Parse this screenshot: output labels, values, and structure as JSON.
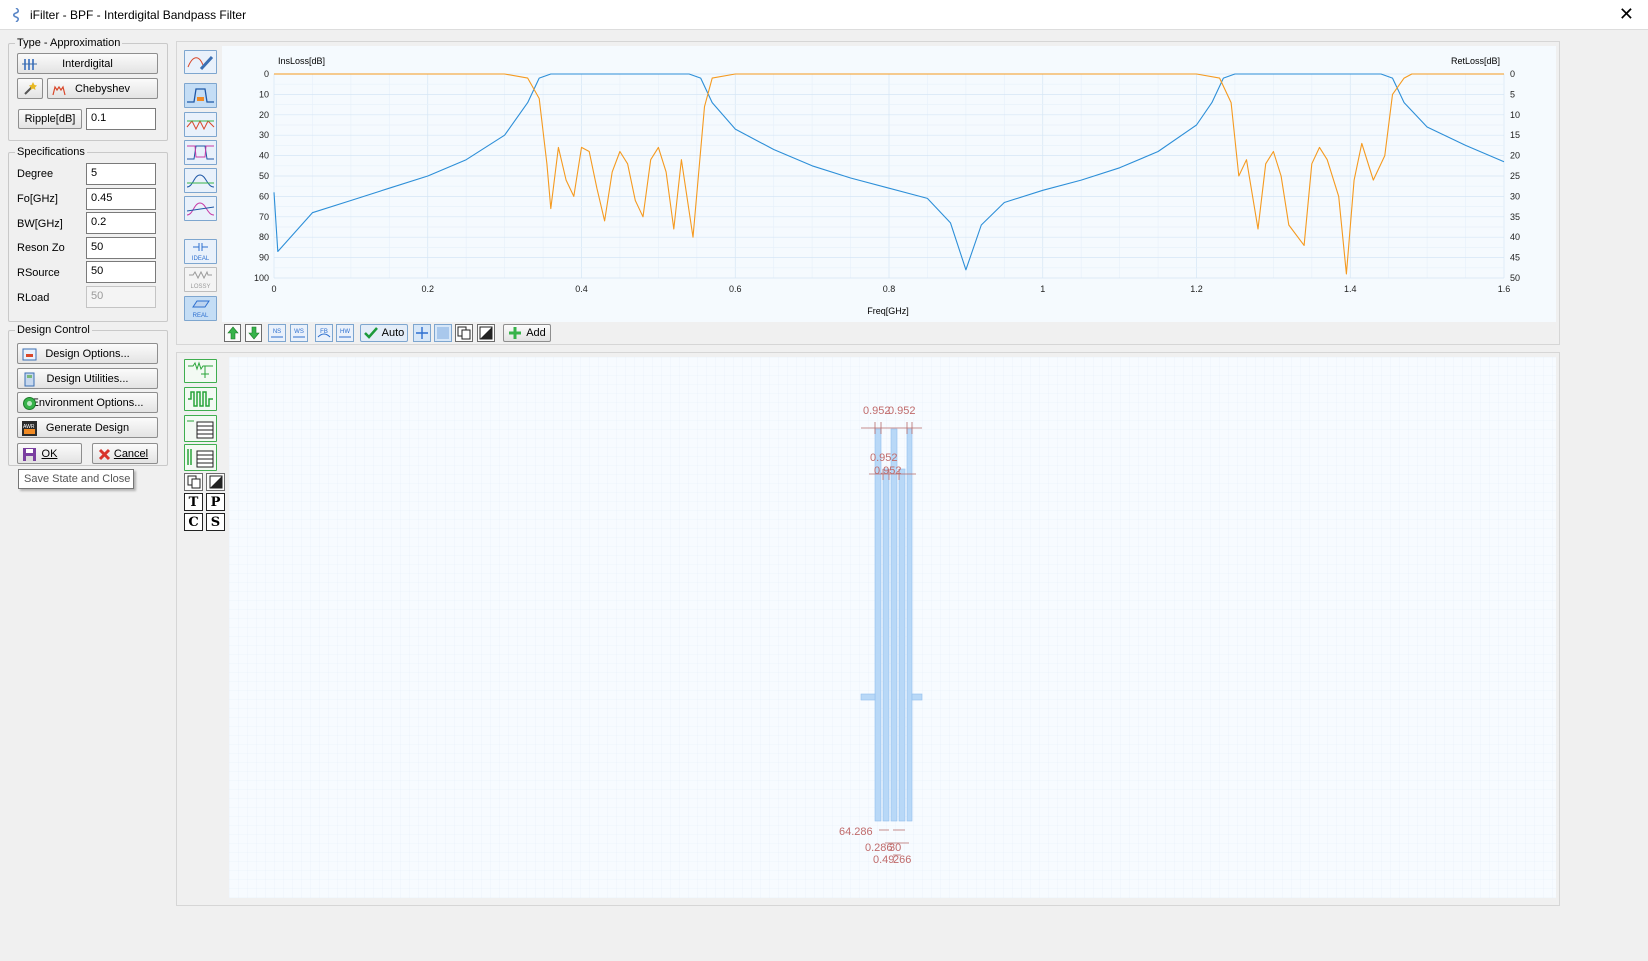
{
  "window": {
    "title": "iFilter - BPF - Interdigital Bandpass Filter"
  },
  "type_group": {
    "title": "Type - Approximation",
    "type_label": "Interdigital",
    "approx_label": "Chebyshev",
    "ripple_label": "Ripple[dB]",
    "ripple_value": "0.1"
  },
  "specs": {
    "title": "Specifications",
    "fields": [
      {
        "label": "Degree",
        "value": "5"
      },
      {
        "label": "Fo[GHz]",
        "value": "0.45"
      },
      {
        "label": "BW[GHz]",
        "value": "0.2"
      },
      {
        "label": "Reson Zo",
        "value": "50"
      },
      {
        "label": "RSource",
        "value": "50"
      },
      {
        "label": "RLoad",
        "value": "50"
      }
    ]
  },
  "design_control": {
    "title": "Design Control",
    "design_options": "Design Options...",
    "design_utilities": "Design Utilities...",
    "environment_options": "Environment Options...",
    "generate_design": "Generate Design",
    "ok": "OK",
    "cancel": "Cancel",
    "tooltip": "Save State and Close"
  },
  "side_icons": {
    "ideal": "IDEAL",
    "lossy": "LOSSY",
    "real": "REAL"
  },
  "chart_toolbar": {
    "auto": "Auto",
    "add": "Add",
    "mini_labels": [
      "NS",
      "WS",
      "FB",
      "HW"
    ]
  },
  "layout_tools": {
    "letters": [
      "T",
      "P",
      "C",
      "S"
    ]
  },
  "chart_data": {
    "type": "line",
    "x_label": "Freq[GHz]",
    "y_left_label": "InsLoss[dB]",
    "y_right_label": "RetLoss[dB]",
    "xlim": [
      0,
      1.6
    ],
    "ylim_left": [
      0,
      100
    ],
    "ylim_right": [
      0,
      50
    ],
    "x_ticks": [
      "0",
      "0.2",
      "0.4",
      "0.6",
      "0.8",
      "1",
      "1.2",
      "1.4",
      "1.6"
    ],
    "y_left_ticks": [
      "0",
      "10",
      "20",
      "30",
      "40",
      "50",
      "60",
      "70",
      "80",
      "90",
      "100"
    ],
    "y_right_ticks": [
      "0",
      "5",
      "10",
      "15",
      "20",
      "25",
      "30",
      "35",
      "40",
      "45",
      "50"
    ],
    "grid": true,
    "series": [
      {
        "name": "InsLoss[dB]",
        "axis": "left",
        "color": "#2d8fd8",
        "x": [
          0,
          0.005,
          0.05,
          0.1,
          0.15,
          0.2,
          0.25,
          0.3,
          0.33,
          0.345,
          0.36,
          0.4,
          0.45,
          0.5,
          0.54,
          0.555,
          0.57,
          0.6,
          0.65,
          0.7,
          0.75,
          0.8,
          0.85,
          0.88,
          0.9,
          0.92,
          0.95,
          1.0,
          1.05,
          1.1,
          1.15,
          1.2,
          1.22,
          1.235,
          1.25,
          1.3,
          1.35,
          1.4,
          1.44,
          1.455,
          1.47,
          1.5,
          1.55,
          1.6
        ],
        "y": [
          58,
          87,
          68,
          62,
          56,
          50,
          42,
          30,
          14,
          2,
          0,
          0,
          0,
          0,
          0,
          2,
          14,
          27,
          37,
          45,
          51,
          56,
          61,
          73,
          96,
          74,
          63,
          57,
          52,
          46,
          38,
          25,
          14,
          2,
          0,
          0,
          0,
          0,
          0,
          2,
          14,
          26,
          35,
          43
        ]
      },
      {
        "name": "RetLoss[dB]",
        "axis": "right",
        "color": "#f59a1f",
        "x": [
          0,
          0.3,
          0.33,
          0.345,
          0.355,
          0.36,
          0.37,
          0.38,
          0.39,
          0.4,
          0.41,
          0.42,
          0.43,
          0.44,
          0.45,
          0.46,
          0.47,
          0.48,
          0.49,
          0.5,
          0.51,
          0.52,
          0.53,
          0.545,
          0.56,
          0.57,
          0.6,
          1.2,
          1.23,
          1.245,
          1.255,
          1.265,
          1.28,
          1.29,
          1.3,
          1.31,
          1.32,
          1.34,
          1.35,
          1.36,
          1.37,
          1.385,
          1.395,
          1.405,
          1.415,
          1.43,
          1.445,
          1.455,
          1.47,
          1.48,
          1.5,
          1.6
        ],
        "y": [
          0,
          0,
          1,
          6,
          22,
          33,
          18,
          26,
          30,
          18,
          19,
          28,
          36,
          24,
          19,
          22,
          31,
          35,
          21,
          18,
          24,
          38,
          21,
          40,
          8,
          1,
          0,
          0,
          1,
          7,
          25,
          21,
          38,
          22,
          19,
          25,
          37,
          42,
          22,
          18,
          21,
          30,
          49,
          26,
          17,
          26,
          20,
          5,
          1,
          0,
          0,
          0
        ]
      }
    ]
  }
}
